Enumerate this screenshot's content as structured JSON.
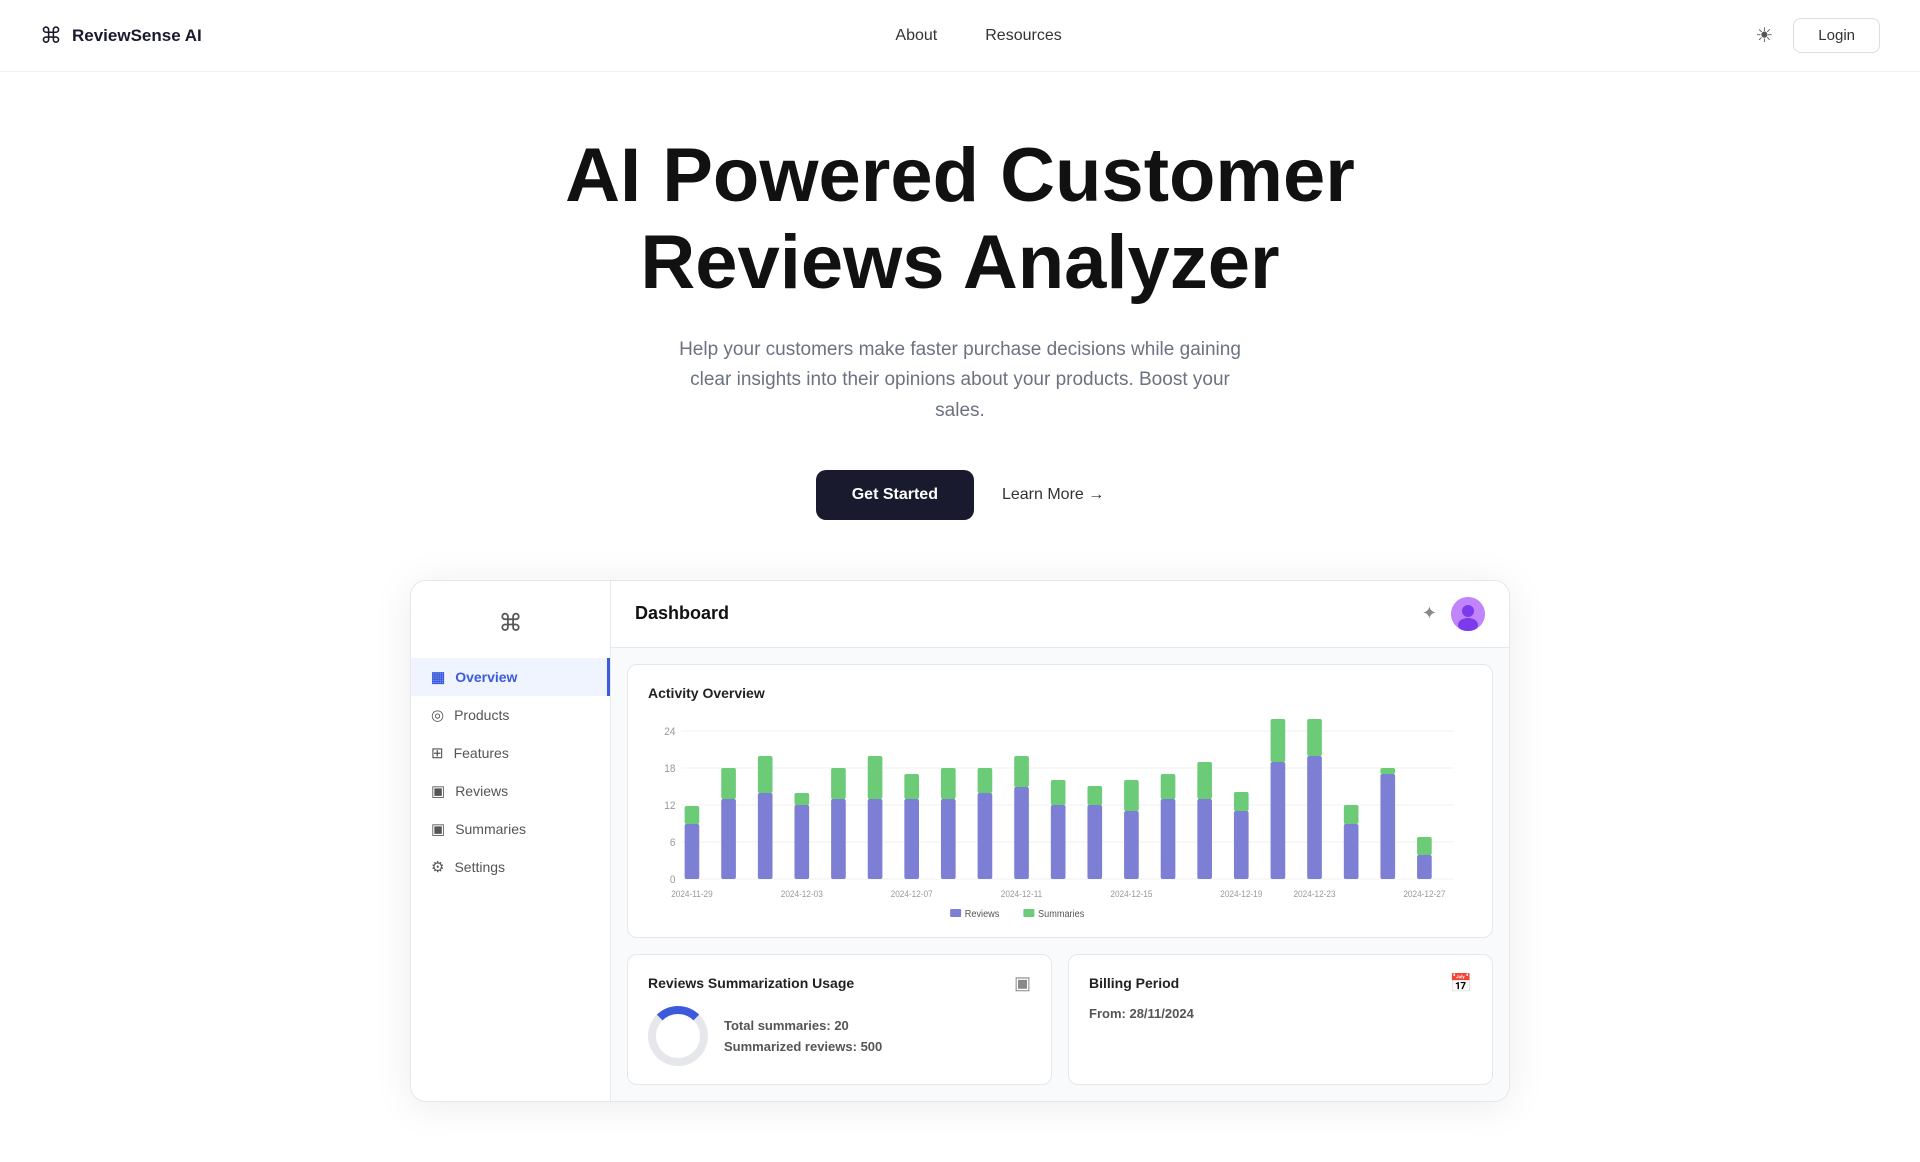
{
  "brand": {
    "name": "ReviewSense AI",
    "logo_icon": "⌘"
  },
  "navbar": {
    "about_label": "About",
    "resources_label": "Resources",
    "login_label": "Login",
    "theme_icon": "☀"
  },
  "hero": {
    "title_line1": "AI Powered Customer",
    "title_line2": "Reviews Analyzer",
    "subtitle": "Help your customers make faster purchase decisions while gaining clear insights into their opinions about your products. Boost your sales.",
    "cta_primary": "Get Started",
    "cta_secondary": "Learn More →"
  },
  "dashboard": {
    "title": "Dashboard",
    "settings_icon": "✦",
    "sidebar_logo": "⌘",
    "sidebar_items": [
      {
        "id": "overview",
        "label": "Overview",
        "icon": "▦",
        "active": true
      },
      {
        "id": "products",
        "label": "Products",
        "icon": "◎"
      },
      {
        "id": "features",
        "label": "Features",
        "icon": "⊞"
      },
      {
        "id": "reviews",
        "label": "Reviews",
        "icon": "▣"
      },
      {
        "id": "summaries",
        "label": "Summaries",
        "icon": "▣"
      },
      {
        "id": "settings",
        "label": "Settings",
        "icon": "⚙"
      }
    ],
    "chart": {
      "title": "Activity Overview",
      "legend_reviews": "Reviews",
      "legend_summaries": "Summaries",
      "y_labels": [
        "24",
        "18",
        "12",
        "6",
        "0"
      ],
      "x_labels": [
        "2024-11-29",
        "2024-12-03",
        "2024-12-07",
        "2024-12-11",
        "2024-12-15",
        "2024-12-19",
        "2024-12-23",
        "2024-12-27"
      ],
      "bars": [
        {
          "reviews": 9,
          "summaries": 3
        },
        {
          "reviews": 13,
          "summaries": 5
        },
        {
          "reviews": 14,
          "summaries": 6
        },
        {
          "reviews": 12,
          "summaries": 2
        },
        {
          "reviews": 13,
          "summaries": 5
        },
        {
          "reviews": 13,
          "summaries": 7
        },
        {
          "reviews": 13,
          "summaries": 4
        },
        {
          "reviews": 13,
          "summaries": 5
        },
        {
          "reviews": 14,
          "summaries": 4
        },
        {
          "reviews": 15,
          "summaries": 5
        },
        {
          "reviews": 12,
          "summaries": 4
        },
        {
          "reviews": 12,
          "summaries": 3
        },
        {
          "reviews": 11,
          "summaries": 5
        },
        {
          "reviews": 13,
          "summaries": 4
        },
        {
          "reviews": 13,
          "summaries": 6
        },
        {
          "reviews": 11,
          "summaries": 3
        },
        {
          "reviews": 19,
          "summaries": 7
        },
        {
          "reviews": 20,
          "summaries": 7
        },
        {
          "reviews": 9,
          "summaries": 3
        },
        {
          "reviews": 17,
          "summaries": 1
        },
        {
          "reviews": 4,
          "summaries": 3
        }
      ]
    },
    "usage_card": {
      "title": "Reviews Summarization Usage",
      "icon": "▣",
      "total_summaries_label": "Total summaries:",
      "total_summaries_value": "20",
      "summarized_reviews_label": "Summarized reviews:",
      "summarized_reviews_value": "500"
    },
    "billing_card": {
      "title": "Billing Period",
      "icon": "📅",
      "from_label": "From:",
      "from_value": "28/11/2024"
    }
  }
}
